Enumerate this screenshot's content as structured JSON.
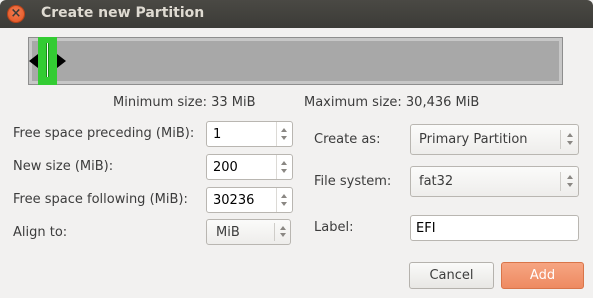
{
  "window": {
    "title": "Create new Partition",
    "close_symbol": "×"
  },
  "partition_bar": {
    "colors": {
      "free": "#a8a8a8",
      "new_partition": "#33cc33"
    }
  },
  "sizes": {
    "minimum": "Minimum size: 33 MiB",
    "maximum": "Maximum size: 30,436 MiB"
  },
  "left_form": {
    "free_preceding": {
      "label": "Free space preceding (MiB):",
      "value": "1"
    },
    "new_size": {
      "label": "New size (MiB):",
      "value": "200"
    },
    "free_following": {
      "label": "Free space following (MiB):",
      "value": "30236"
    },
    "align_to": {
      "label": "Align to:",
      "value": "MiB"
    }
  },
  "right_form": {
    "create_as": {
      "label": "Create as:",
      "value": "Primary Partition"
    },
    "file_system": {
      "label": "File system:",
      "value": "fat32"
    },
    "partition_label": {
      "label": "Label:",
      "value": "EFI"
    }
  },
  "buttons": {
    "cancel": "Cancel",
    "add": "Add"
  },
  "colors": {
    "accent": "#ee8a61",
    "titlebar": "#3c3b37"
  }
}
